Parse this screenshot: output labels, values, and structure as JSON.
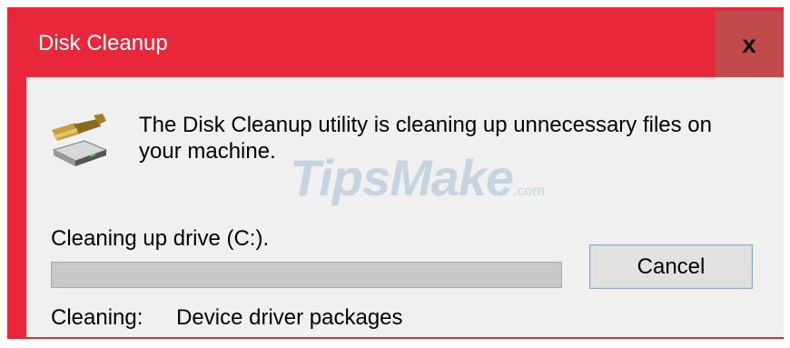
{
  "window": {
    "title": "Disk Cleanup",
    "close_glyph": "x",
    "accent_color": "#e8283a"
  },
  "dialog": {
    "icon": "disk-cleanup-icon",
    "message": "The Disk Cleanup utility is cleaning up unnecessary files on your machine.",
    "drive_label": "Cleaning up drive  (C:).",
    "progress": 0,
    "cancel_label": "Cancel",
    "status_label": "Cleaning:",
    "status_value": "Device driver packages"
  },
  "watermark": {
    "text": "TipsMake",
    "suffix": ".com"
  }
}
